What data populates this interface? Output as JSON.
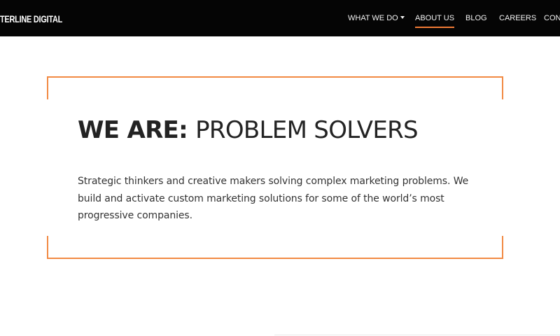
{
  "header": {
    "brand": "TERLINE DIGITAL",
    "nav_items": [
      {
        "label": "WHAT WE DO",
        "has_dropdown": true
      },
      {
        "label": "ABOUT US",
        "active": true
      },
      {
        "label": "BLOG"
      },
      {
        "label": "CAREERS"
      },
      {
        "label": "CON"
      }
    ]
  },
  "hero": {
    "headline_strong": "WE ARE:",
    "headline_rest": "PROBLEM SOLVERS",
    "description_lines": [
      "Strategic thinkers and creative makers solving complex marketing problems. We",
      "build and activate custom marketing solutions for some of the world’s most",
      "progressive companies."
    ]
  },
  "colors": {
    "header_background": "#050505",
    "accent": "#f28a43",
    "headline_text": "#232323",
    "body_text": "#333333"
  },
  "icons": {
    "dropdown": "chevron-down-icon"
  }
}
